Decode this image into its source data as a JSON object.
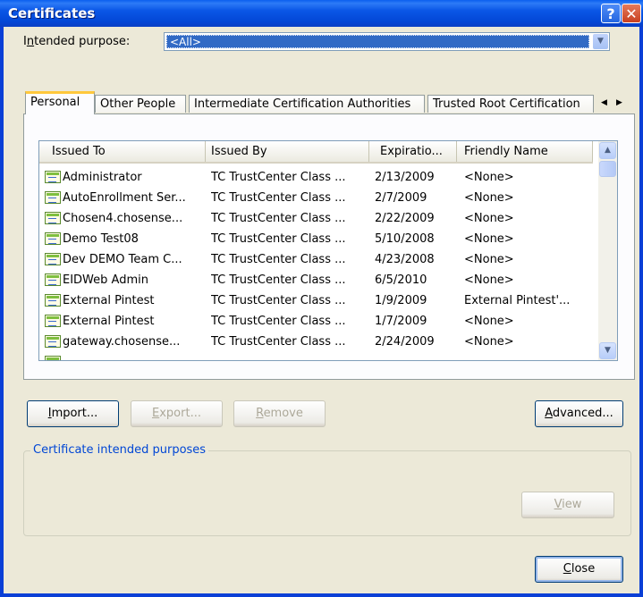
{
  "window": {
    "title": "Certificates"
  },
  "purpose": {
    "label_prefix": "I",
    "label_ul": "n",
    "label_rest": "tended purpose:",
    "value": "<All>"
  },
  "tabs": [
    {
      "label": "Personal"
    },
    {
      "label": "Other People"
    },
    {
      "label": "Intermediate Certification Authorities"
    },
    {
      "label": "Trusted Root Certification"
    }
  ],
  "columns": [
    "Issued To",
    "Issued By",
    "Expiratio...",
    "Friendly Name"
  ],
  "rows": [
    {
      "issued_to": "Administrator",
      "issued_by": "TC TrustCenter Class ...",
      "expiration": "2/13/2009",
      "friendly": "<None>"
    },
    {
      "issued_to": "AutoEnrollment Ser...",
      "issued_by": "TC TrustCenter Class ...",
      "expiration": "2/7/2009",
      "friendly": "<None>"
    },
    {
      "issued_to": "Chosen4.chosense...",
      "issued_by": "TC TrustCenter Class ...",
      "expiration": "2/22/2009",
      "friendly": "<None>"
    },
    {
      "issued_to": "Demo Test08",
      "issued_by": "TC TrustCenter Class ...",
      "expiration": "5/10/2008",
      "friendly": "<None>"
    },
    {
      "issued_to": "Dev DEMO Team C...",
      "issued_by": "TC TrustCenter Class ...",
      "expiration": "4/23/2008",
      "friendly": "<None>"
    },
    {
      "issued_to": "EIDWeb Admin",
      "issued_by": "TC TrustCenter Class ...",
      "expiration": "6/5/2010",
      "friendly": "<None>"
    },
    {
      "issued_to": "External Pintest",
      "issued_by": "TC TrustCenter Class ...",
      "expiration": "1/9/2009",
      "friendly": "External Pintest'..."
    },
    {
      "issued_to": "External Pintest",
      "issued_by": "TC TrustCenter Class ...",
      "expiration": "1/7/2009",
      "friendly": "<None>"
    },
    {
      "issued_to": "gateway.chosense...",
      "issued_by": "TC TrustCenter Class ...",
      "expiration": "2/24/2009",
      "friendly": "<None>"
    }
  ],
  "buttons": {
    "import": {
      "ul": "I",
      "rest": "mport..."
    },
    "export": {
      "ul": "E",
      "rest": "xport..."
    },
    "remove": {
      "ul": "R",
      "rest": "emove"
    },
    "advanced": {
      "ul": "A",
      "rest": "dvanced..."
    },
    "view": {
      "ul": "V",
      "rest": "iew"
    },
    "close": {
      "ul": "C",
      "rest": "lose"
    }
  },
  "group": {
    "title": "Certificate intended purposes"
  },
  "icons": {
    "help": "help-icon",
    "close": "close-icon",
    "combo_arrow": "chevron-down-icon",
    "tab_left": "chevron-left-icon",
    "tab_right": "chevron-right-icon",
    "scroll_up": "chevron-up-icon",
    "scroll_down": "chevron-down-icon",
    "cert": "certificate-icon"
  },
  "colors": {
    "title_bar": "#0a56e6",
    "dialog_bg": "#ece9d8",
    "selection": "#316ac5",
    "active_tab_accent": "#ffc83c",
    "group_title": "#0046d5"
  }
}
